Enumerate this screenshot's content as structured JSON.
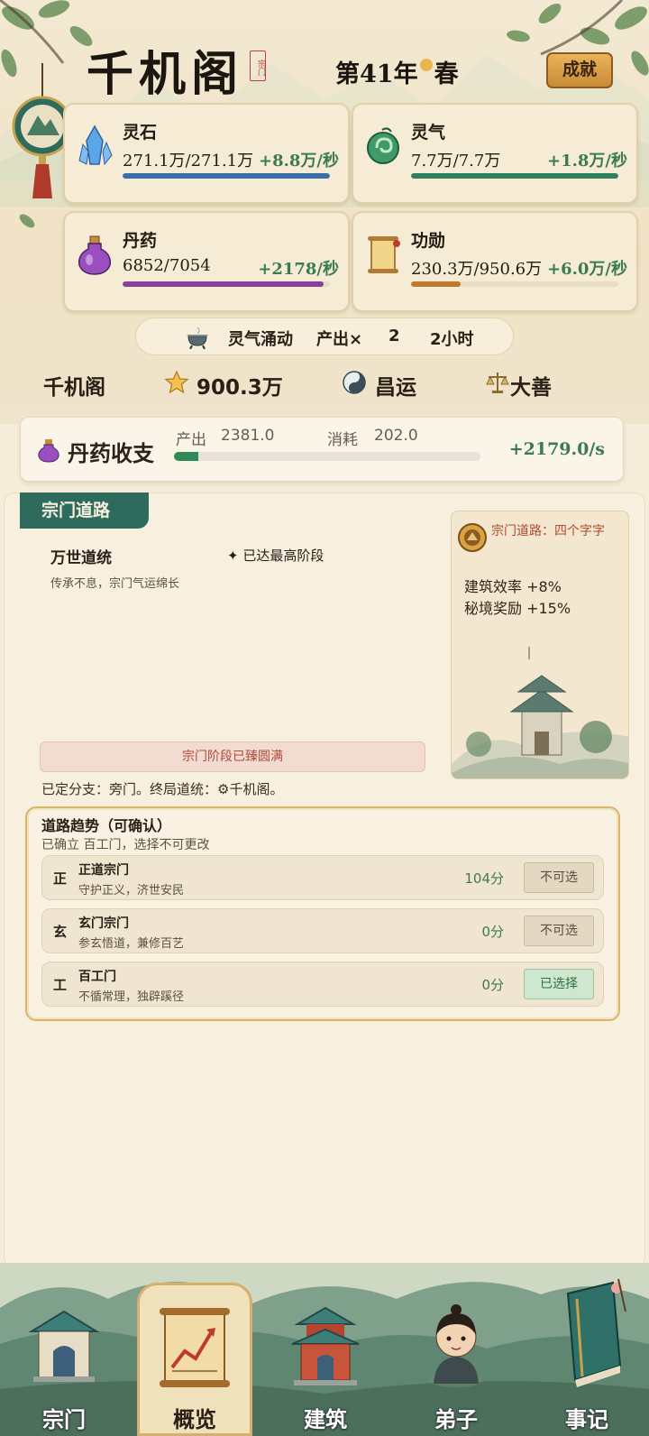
{
  "header": {
    "sect_name": "千机阁",
    "seal": "宗门",
    "year_prefix": "第41年",
    "season": "春",
    "achievements_label": "成就"
  },
  "resources": [
    {
      "name": "灵石",
      "value": "271.1万/271.1万",
      "rate": "+8.8万/秒",
      "fill": 1.0,
      "color": "#3a6ea8",
      "icon": "crystal-icon"
    },
    {
      "name": "灵气",
      "value": "7.7万/7.7万",
      "rate": "+1.8万/秒",
      "fill": 1.0,
      "color": "#2f7f5f",
      "icon": "jade-swirl-icon"
    },
    {
      "name": "丹药",
      "value": "6852/7054",
      "rate": "+2178/秒",
      "fill": 0.97,
      "color": "#8a3f9a",
      "icon": "potion-flask-icon"
    },
    {
      "name": "功勋",
      "value": "230.3万/950.6万",
      "rate": "+6.0万/秒",
      "fill": 0.24,
      "color": "#c07a2e",
      "icon": "scroll-icon"
    }
  ],
  "event": {
    "name": "灵气涌动",
    "output_label": "产出×",
    "multiplier": "2",
    "duration": "2小时"
  },
  "sect_info": {
    "name": "千机阁",
    "prestige": "900.3万",
    "fortune": "昌运",
    "morality": "大善"
  },
  "pill_balance": {
    "title": "丹药收支",
    "output_label": "产出",
    "output_value": "2381.0",
    "consume_label": "消耗",
    "consume_value": "202.0",
    "net_rate": "+2179.0/s",
    "consume_fraction": 0.05
  },
  "sect_path": {
    "tab_label": "宗门道路",
    "stage_name": "万世道统",
    "stage_badge": "已达最高阶段",
    "stage_desc": "传承不息，宗门气运绵长",
    "complete_text": "宗门阶段已臻圆满",
    "branch_text": "已定分支：旁门。终局道统：⚙千机阁。",
    "side_card": {
      "header": "宗门道路：四个字字",
      "bonus1": "建筑效率 +8%",
      "bonus2": "秘境奖励 +15%"
    }
  },
  "trend": {
    "title": "道路趋势（可确认）",
    "subtitle": "已确立 百工门，选择不可更改",
    "options": [
      {
        "glyph": "正",
        "name": "正道宗门",
        "desc": "守护正义，济世安民",
        "score": "104分",
        "button": "不可选"
      },
      {
        "glyph": "玄",
        "name": "玄门宗门",
        "desc": "参玄悟道，兼修百艺",
        "score": "0分",
        "button": "不可选"
      },
      {
        "glyph": "工",
        "name": "百工门",
        "desc": "不循常理，独辟蹊径",
        "score": "0分",
        "button": "已选择"
      }
    ]
  },
  "nav": [
    {
      "label": "宗门",
      "icon": "sect-gate-icon"
    },
    {
      "label": "概览",
      "icon": "overview-scroll-icon",
      "active": true
    },
    {
      "label": "建筑",
      "icon": "pavilion-icon"
    },
    {
      "label": "弟子",
      "icon": "disciple-portrait-icon"
    },
    {
      "label": "事记",
      "icon": "journal-book-icon"
    }
  ]
}
